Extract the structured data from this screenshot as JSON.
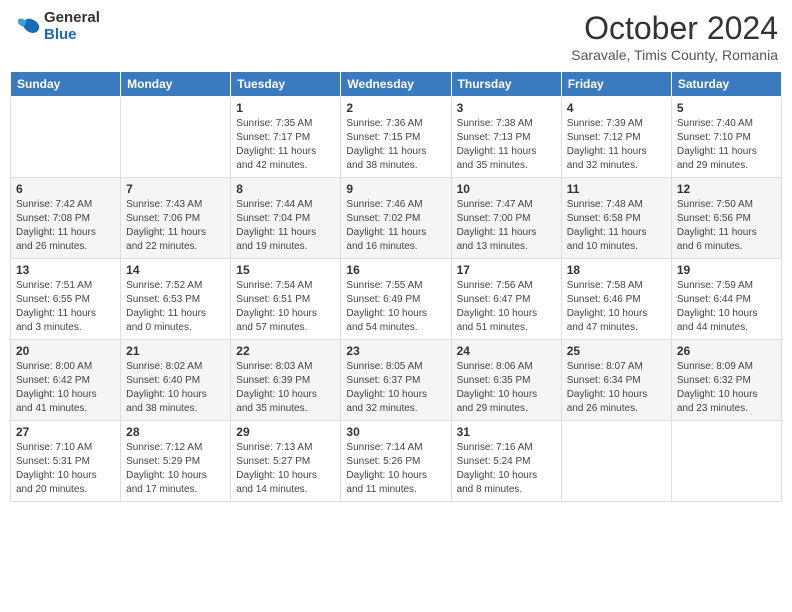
{
  "header": {
    "logo_general": "General",
    "logo_blue": "Blue",
    "month_title": "October 2024",
    "subtitle": "Saravale, Timis County, Romania"
  },
  "weekdays": [
    "Sunday",
    "Monday",
    "Tuesday",
    "Wednesday",
    "Thursday",
    "Friday",
    "Saturday"
  ],
  "weeks": [
    [
      {
        "day": "",
        "info": ""
      },
      {
        "day": "",
        "info": ""
      },
      {
        "day": "1",
        "info": "Sunrise: 7:35 AM\nSunset: 7:17 PM\nDaylight: 11 hours and 42 minutes."
      },
      {
        "day": "2",
        "info": "Sunrise: 7:36 AM\nSunset: 7:15 PM\nDaylight: 11 hours and 38 minutes."
      },
      {
        "day": "3",
        "info": "Sunrise: 7:38 AM\nSunset: 7:13 PM\nDaylight: 11 hours and 35 minutes."
      },
      {
        "day": "4",
        "info": "Sunrise: 7:39 AM\nSunset: 7:12 PM\nDaylight: 11 hours and 32 minutes."
      },
      {
        "day": "5",
        "info": "Sunrise: 7:40 AM\nSunset: 7:10 PM\nDaylight: 11 hours and 29 minutes."
      }
    ],
    [
      {
        "day": "6",
        "info": "Sunrise: 7:42 AM\nSunset: 7:08 PM\nDaylight: 11 hours and 26 minutes."
      },
      {
        "day": "7",
        "info": "Sunrise: 7:43 AM\nSunset: 7:06 PM\nDaylight: 11 hours and 22 minutes."
      },
      {
        "day": "8",
        "info": "Sunrise: 7:44 AM\nSunset: 7:04 PM\nDaylight: 11 hours and 19 minutes."
      },
      {
        "day": "9",
        "info": "Sunrise: 7:46 AM\nSunset: 7:02 PM\nDaylight: 11 hours and 16 minutes."
      },
      {
        "day": "10",
        "info": "Sunrise: 7:47 AM\nSunset: 7:00 PM\nDaylight: 11 hours and 13 minutes."
      },
      {
        "day": "11",
        "info": "Sunrise: 7:48 AM\nSunset: 6:58 PM\nDaylight: 11 hours and 10 minutes."
      },
      {
        "day": "12",
        "info": "Sunrise: 7:50 AM\nSunset: 6:56 PM\nDaylight: 11 hours and 6 minutes."
      }
    ],
    [
      {
        "day": "13",
        "info": "Sunrise: 7:51 AM\nSunset: 6:55 PM\nDaylight: 11 hours and 3 minutes."
      },
      {
        "day": "14",
        "info": "Sunrise: 7:52 AM\nSunset: 6:53 PM\nDaylight: 11 hours and 0 minutes."
      },
      {
        "day": "15",
        "info": "Sunrise: 7:54 AM\nSunset: 6:51 PM\nDaylight: 10 hours and 57 minutes."
      },
      {
        "day": "16",
        "info": "Sunrise: 7:55 AM\nSunset: 6:49 PM\nDaylight: 10 hours and 54 minutes."
      },
      {
        "day": "17",
        "info": "Sunrise: 7:56 AM\nSunset: 6:47 PM\nDaylight: 10 hours and 51 minutes."
      },
      {
        "day": "18",
        "info": "Sunrise: 7:58 AM\nSunset: 6:46 PM\nDaylight: 10 hours and 47 minutes."
      },
      {
        "day": "19",
        "info": "Sunrise: 7:59 AM\nSunset: 6:44 PM\nDaylight: 10 hours and 44 minutes."
      }
    ],
    [
      {
        "day": "20",
        "info": "Sunrise: 8:00 AM\nSunset: 6:42 PM\nDaylight: 10 hours and 41 minutes."
      },
      {
        "day": "21",
        "info": "Sunrise: 8:02 AM\nSunset: 6:40 PM\nDaylight: 10 hours and 38 minutes."
      },
      {
        "day": "22",
        "info": "Sunrise: 8:03 AM\nSunset: 6:39 PM\nDaylight: 10 hours and 35 minutes."
      },
      {
        "day": "23",
        "info": "Sunrise: 8:05 AM\nSunset: 6:37 PM\nDaylight: 10 hours and 32 minutes."
      },
      {
        "day": "24",
        "info": "Sunrise: 8:06 AM\nSunset: 6:35 PM\nDaylight: 10 hours and 29 minutes."
      },
      {
        "day": "25",
        "info": "Sunrise: 8:07 AM\nSunset: 6:34 PM\nDaylight: 10 hours and 26 minutes."
      },
      {
        "day": "26",
        "info": "Sunrise: 8:09 AM\nSunset: 6:32 PM\nDaylight: 10 hours and 23 minutes."
      }
    ],
    [
      {
        "day": "27",
        "info": "Sunrise: 7:10 AM\nSunset: 5:31 PM\nDaylight: 10 hours and 20 minutes."
      },
      {
        "day": "28",
        "info": "Sunrise: 7:12 AM\nSunset: 5:29 PM\nDaylight: 10 hours and 17 minutes."
      },
      {
        "day": "29",
        "info": "Sunrise: 7:13 AM\nSunset: 5:27 PM\nDaylight: 10 hours and 14 minutes."
      },
      {
        "day": "30",
        "info": "Sunrise: 7:14 AM\nSunset: 5:26 PM\nDaylight: 10 hours and 11 minutes."
      },
      {
        "day": "31",
        "info": "Sunrise: 7:16 AM\nSunset: 5:24 PM\nDaylight: 10 hours and 8 minutes."
      },
      {
        "day": "",
        "info": ""
      },
      {
        "day": "",
        "info": ""
      }
    ]
  ]
}
